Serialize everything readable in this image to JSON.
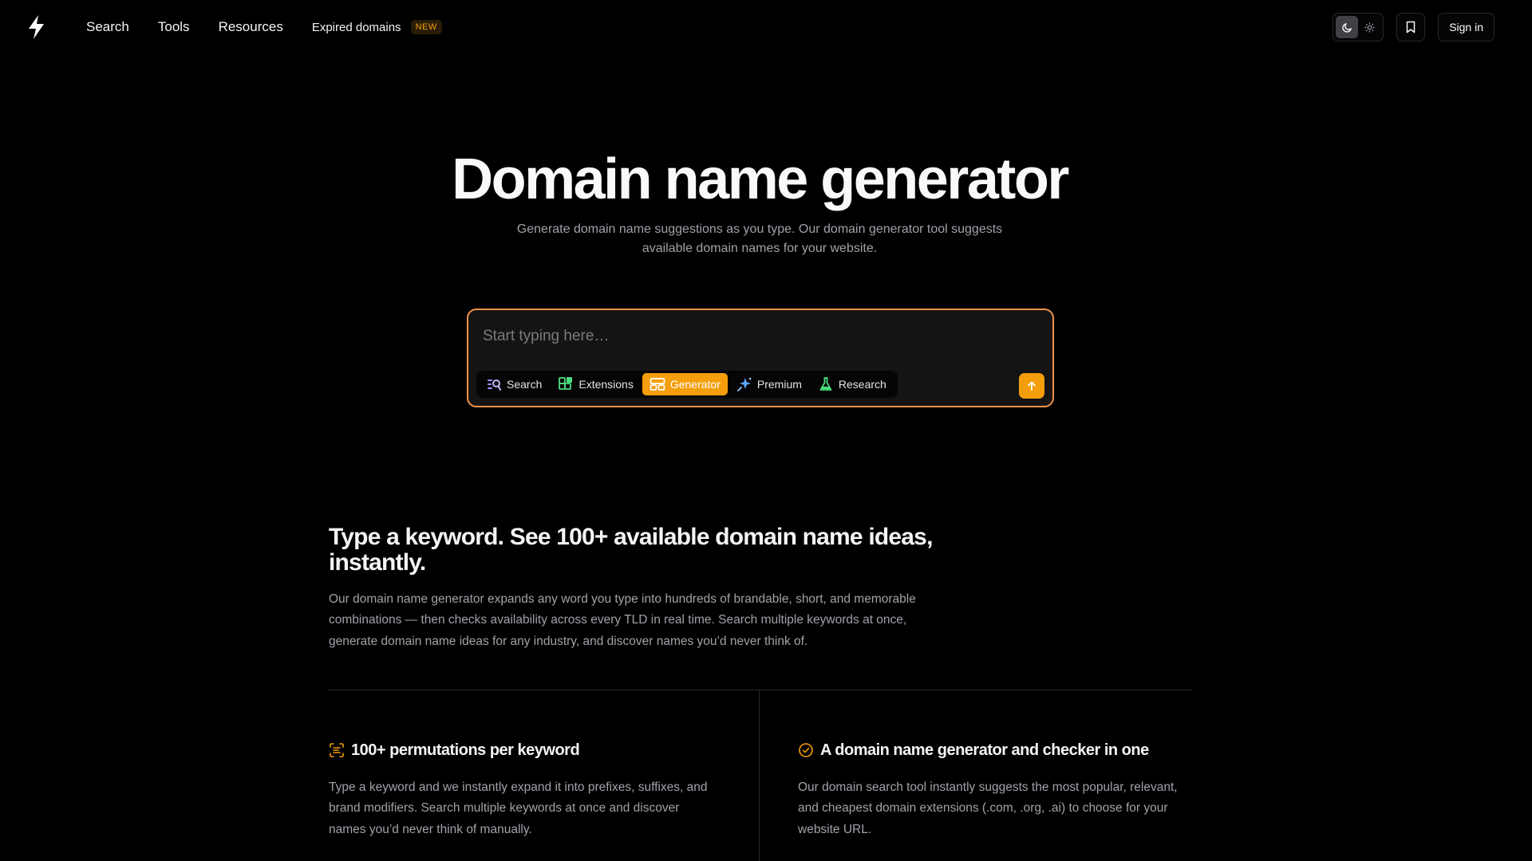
{
  "nav": {
    "links": [
      "Search",
      "Tools",
      "Resources"
    ],
    "expired": "Expired domains",
    "new_badge": "NEW",
    "signin": "Sign in"
  },
  "hero": {
    "title": "Domain name generator",
    "subtitle_line1": "Generate domain name suggestions as you type. Our domain generator tool suggests",
    "subtitle_line2": "available domain names for your website."
  },
  "search": {
    "placeholder": "Start typing here…",
    "value": "",
    "modes": [
      {
        "label": "Search",
        "icon": "search-list-icon",
        "color": "#a78bfa",
        "active": false
      },
      {
        "label": "Extensions",
        "icon": "extensions-blocks-icon",
        "color": "#4ade80",
        "active": false
      },
      {
        "label": "Generator",
        "icon": "generator-cards-icon",
        "color": "#ffffff",
        "active": true
      },
      {
        "label": "Premium",
        "icon": "premium-sparkle-icon",
        "color": "#60a5fa",
        "active": false
      },
      {
        "label": "Research",
        "icon": "research-flask-icon",
        "color": "#4ade80",
        "active": false
      }
    ],
    "submit_icon": "arrow-up-icon"
  },
  "section": {
    "title_line1": "Type a keyword. See 100+ available domain name ideas,",
    "title_line2": "instantly.",
    "body_line1": "Our domain name generator expands any word you type into hundreds of brandable, short, and memorable",
    "body_line2": "combinations — then checks availability across every TLD in real time. Search multiple keywords at once,",
    "body_line3": "generate domain name ideas for any industry, and discover names you’d never think of."
  },
  "features": [
    {
      "title": "100+ permutations per keyword",
      "icon": "scan-text-icon",
      "lines": [
        "Type a keyword and we instantly expand it into prefixes, suffixes, and",
        "brand modifiers. Search multiple keywords at once and discover",
        "names you’d never think of manually."
      ]
    },
    {
      "title": "A domain name generator and checker in one",
      "icon": "check-circle-icon",
      "lines": [
        "Our domain search tool instantly suggests the most popular, relevant,",
        "and cheapest domain extensions (.com, .org, .ai) to choose for your",
        "website URL."
      ]
    }
  ],
  "colors": {
    "accent": "#f59e0b",
    "search_border": "#f0924a",
    "background": "#000000"
  }
}
